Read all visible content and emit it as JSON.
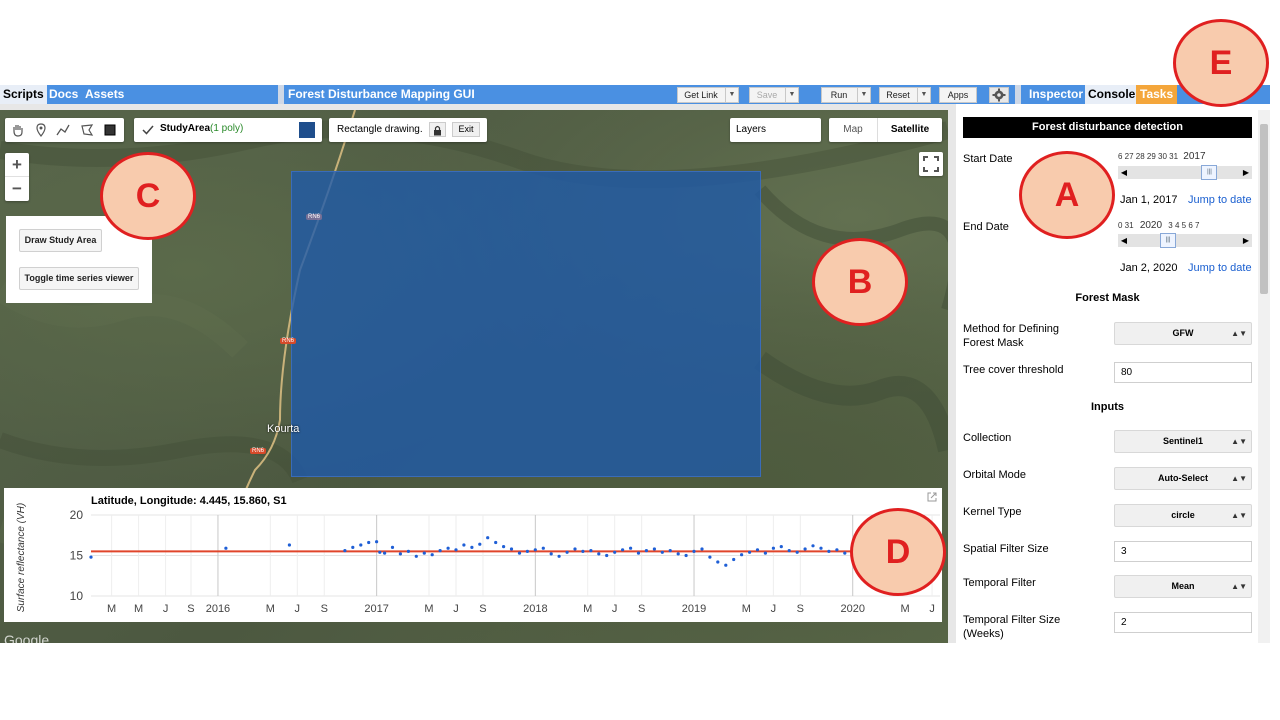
{
  "topbar": {
    "tabs_left": [
      "Scripts",
      "Docs",
      "Assets"
    ],
    "title": "Forest Disturbance Mapping GUI",
    "buttons": {
      "get_link": "Get Link",
      "save": "Save",
      "run": "Run",
      "reset": "Reset",
      "apps": "Apps"
    },
    "tabs_right": [
      "Inspector",
      "Console",
      "Tasks"
    ]
  },
  "map": {
    "layer_name": "StudyArea",
    "layer_count": "(1 poly)",
    "layer_color": "#1f4e8c",
    "rect_drawing": "Rectangle drawing.",
    "exit": "Exit",
    "layers": "Layers",
    "map_types": [
      "Map",
      "Satellite"
    ],
    "town": "Kourta",
    "road": "RN6",
    "google": "Google",
    "buttons": [
      "Draw Study Area",
      "Toggle time series viewer"
    ]
  },
  "chart_data": {
    "type": "scatter",
    "title": "Latitude, Longitude: 4.445, 15.860, S1",
    "ylabel": "Surface reflectance (VH)",
    "ylim": [
      10,
      20
    ],
    "yticks": [
      20,
      15,
      10
    ],
    "xlim": [
      2015.2,
      2020.55
    ],
    "xticks": [
      {
        "t": 2015.33,
        "label": "M"
      },
      {
        "t": 2015.5,
        "label": "M"
      },
      {
        "t": 2015.67,
        "label": "J"
      },
      {
        "t": 2015.83,
        "label": "S"
      },
      {
        "t": 2016.0,
        "label": "2016"
      },
      {
        "t": 2016.33,
        "label": "M"
      },
      {
        "t": 2016.5,
        "label": "J"
      },
      {
        "t": 2016.67,
        "label": "S"
      },
      {
        "t": 2017.0,
        "label": "2017"
      },
      {
        "t": 2017.33,
        "label": "M"
      },
      {
        "t": 2017.5,
        "label": "J"
      },
      {
        "t": 2017.67,
        "label": "S"
      },
      {
        "t": 2018.0,
        "label": "2018"
      },
      {
        "t": 2018.33,
        "label": "M"
      },
      {
        "t": 2018.5,
        "label": "J"
      },
      {
        "t": 2018.67,
        "label": "S"
      },
      {
        "t": 2019.0,
        "label": "2019"
      },
      {
        "t": 2019.33,
        "label": "M"
      },
      {
        "t": 2019.5,
        "label": "J"
      },
      {
        "t": 2019.67,
        "label": "S"
      },
      {
        "t": 2020.0,
        "label": "2020"
      },
      {
        "t": 2020.33,
        "label": "M"
      },
      {
        "t": 2020.5,
        "label": "J"
      }
    ],
    "series": [
      {
        "type": "line",
        "color": "#e0452b",
        "points": [
          [
            2015.2,
            15.5
          ],
          [
            2020.1,
            15.5
          ]
        ]
      },
      {
        "type": "line",
        "color": "#f0a020",
        "points": [
          [
            2020.13,
            13.8
          ],
          [
            2020.45,
            13.8
          ]
        ]
      },
      {
        "type": "scatter",
        "color": "#1f5fd6",
        "points": [
          [
            2015.2,
            14.8
          ],
          [
            2016.05,
            15.9
          ],
          [
            2016.45,
            16.3
          ],
          [
            2016.8,
            15.6
          ],
          [
            2016.85,
            16.0
          ],
          [
            2016.9,
            16.3
          ],
          [
            2016.95,
            16.6
          ],
          [
            2017.0,
            16.7
          ],
          [
            2017.02,
            15.4
          ],
          [
            2017.05,
            15.3
          ],
          [
            2017.1,
            16.0
          ],
          [
            2017.15,
            15.2
          ],
          [
            2017.2,
            15.5
          ],
          [
            2017.25,
            14.9
          ],
          [
            2017.3,
            15.3
          ],
          [
            2017.35,
            15.1
          ],
          [
            2017.4,
            15.6
          ],
          [
            2017.45,
            15.9
          ],
          [
            2017.5,
            15.7
          ],
          [
            2017.55,
            16.3
          ],
          [
            2017.6,
            16.0
          ],
          [
            2017.65,
            16.4
          ],
          [
            2017.7,
            17.2
          ],
          [
            2017.75,
            16.6
          ],
          [
            2017.8,
            16.1
          ],
          [
            2017.85,
            15.8
          ],
          [
            2017.9,
            15.3
          ],
          [
            2017.95,
            15.5
          ],
          [
            2018.0,
            15.7
          ],
          [
            2018.05,
            15.9
          ],
          [
            2018.1,
            15.2
          ],
          [
            2018.15,
            14.9
          ],
          [
            2018.2,
            15.4
          ],
          [
            2018.25,
            15.8
          ],
          [
            2018.3,
            15.5
          ],
          [
            2018.35,
            15.6
          ],
          [
            2018.4,
            15.2
          ],
          [
            2018.45,
            15.0
          ],
          [
            2018.5,
            15.4
          ],
          [
            2018.55,
            15.7
          ],
          [
            2018.6,
            15.9
          ],
          [
            2018.65,
            15.3
          ],
          [
            2018.7,
            15.6
          ],
          [
            2018.75,
            15.8
          ],
          [
            2018.8,
            15.4
          ],
          [
            2018.85,
            15.6
          ],
          [
            2018.9,
            15.2
          ],
          [
            2018.95,
            15.0
          ],
          [
            2019.0,
            15.5
          ],
          [
            2019.05,
            15.8
          ],
          [
            2019.1,
            14.8
          ],
          [
            2019.15,
            14.2
          ],
          [
            2019.2,
            13.8
          ],
          [
            2019.25,
            14.5
          ],
          [
            2019.3,
            15.1
          ],
          [
            2019.35,
            15.4
          ],
          [
            2019.4,
            15.7
          ],
          [
            2019.45,
            15.3
          ],
          [
            2019.5,
            15.9
          ],
          [
            2019.55,
            16.1
          ],
          [
            2019.6,
            15.6
          ],
          [
            2019.65,
            15.4
          ],
          [
            2019.7,
            15.8
          ],
          [
            2019.75,
            16.2
          ],
          [
            2019.8,
            15.9
          ],
          [
            2019.85,
            15.5
          ],
          [
            2019.9,
            15.7
          ],
          [
            2019.95,
            15.3
          ],
          [
            2020.0,
            14.6
          ],
          [
            2020.03,
            14.2
          ],
          [
            2020.06,
            13.5
          ],
          [
            2020.1,
            13.2
          ],
          [
            2020.15,
            12.8
          ],
          [
            2020.2,
            12.9
          ],
          [
            2020.25,
            13.1
          ],
          [
            2020.3,
            12.8
          ],
          [
            2020.35,
            13.0
          ],
          [
            2020.4,
            13.3
          ],
          [
            2020.45,
            14.2
          ],
          [
            2020.5,
            14.9
          ],
          [
            2020.53,
            15.3
          ]
        ]
      }
    ]
  },
  "right_panel": {
    "header": "Forest disturbance detection",
    "start_date": {
      "label": "Start Date",
      "ticks": "6  27  28  29  30  31",
      "year": "2017",
      "value": "Jan 1, 2017",
      "jump": "Jump to date",
      "thumb_frac": 0.76
    },
    "end_date": {
      "label": "End Date",
      "ticks_left": "0  31",
      "year": "2020",
      "ticks_right": "3  4  5  6  7",
      "value": "Jan 2, 2020",
      "jump": "Jump to date",
      "thumb_frac": 0.32
    },
    "forest_mask": {
      "title": "Forest Mask",
      "method_label": "Method for Defining Forest Mask",
      "method_value": "GFW",
      "threshold_label": "Tree cover threshold",
      "threshold_value": "80"
    },
    "inputs": {
      "title": "Inputs",
      "collection_label": "Collection",
      "collection_value": "Sentinel1",
      "orbital_label": "Orbital Mode",
      "orbital_value": "Auto-Select",
      "kernel_label": "Kernel Type",
      "kernel_value": "circle",
      "spatial_label": "Spatial Filter Size",
      "spatial_value": "3",
      "temporal_label": "Temporal Filter",
      "temporal_value": "Mean",
      "temporal_size_label": "Temporal Filter Size (Weeks)",
      "temporal_size_value": "2"
    }
  },
  "annotations": [
    "A",
    "B",
    "C",
    "D",
    "E"
  ]
}
